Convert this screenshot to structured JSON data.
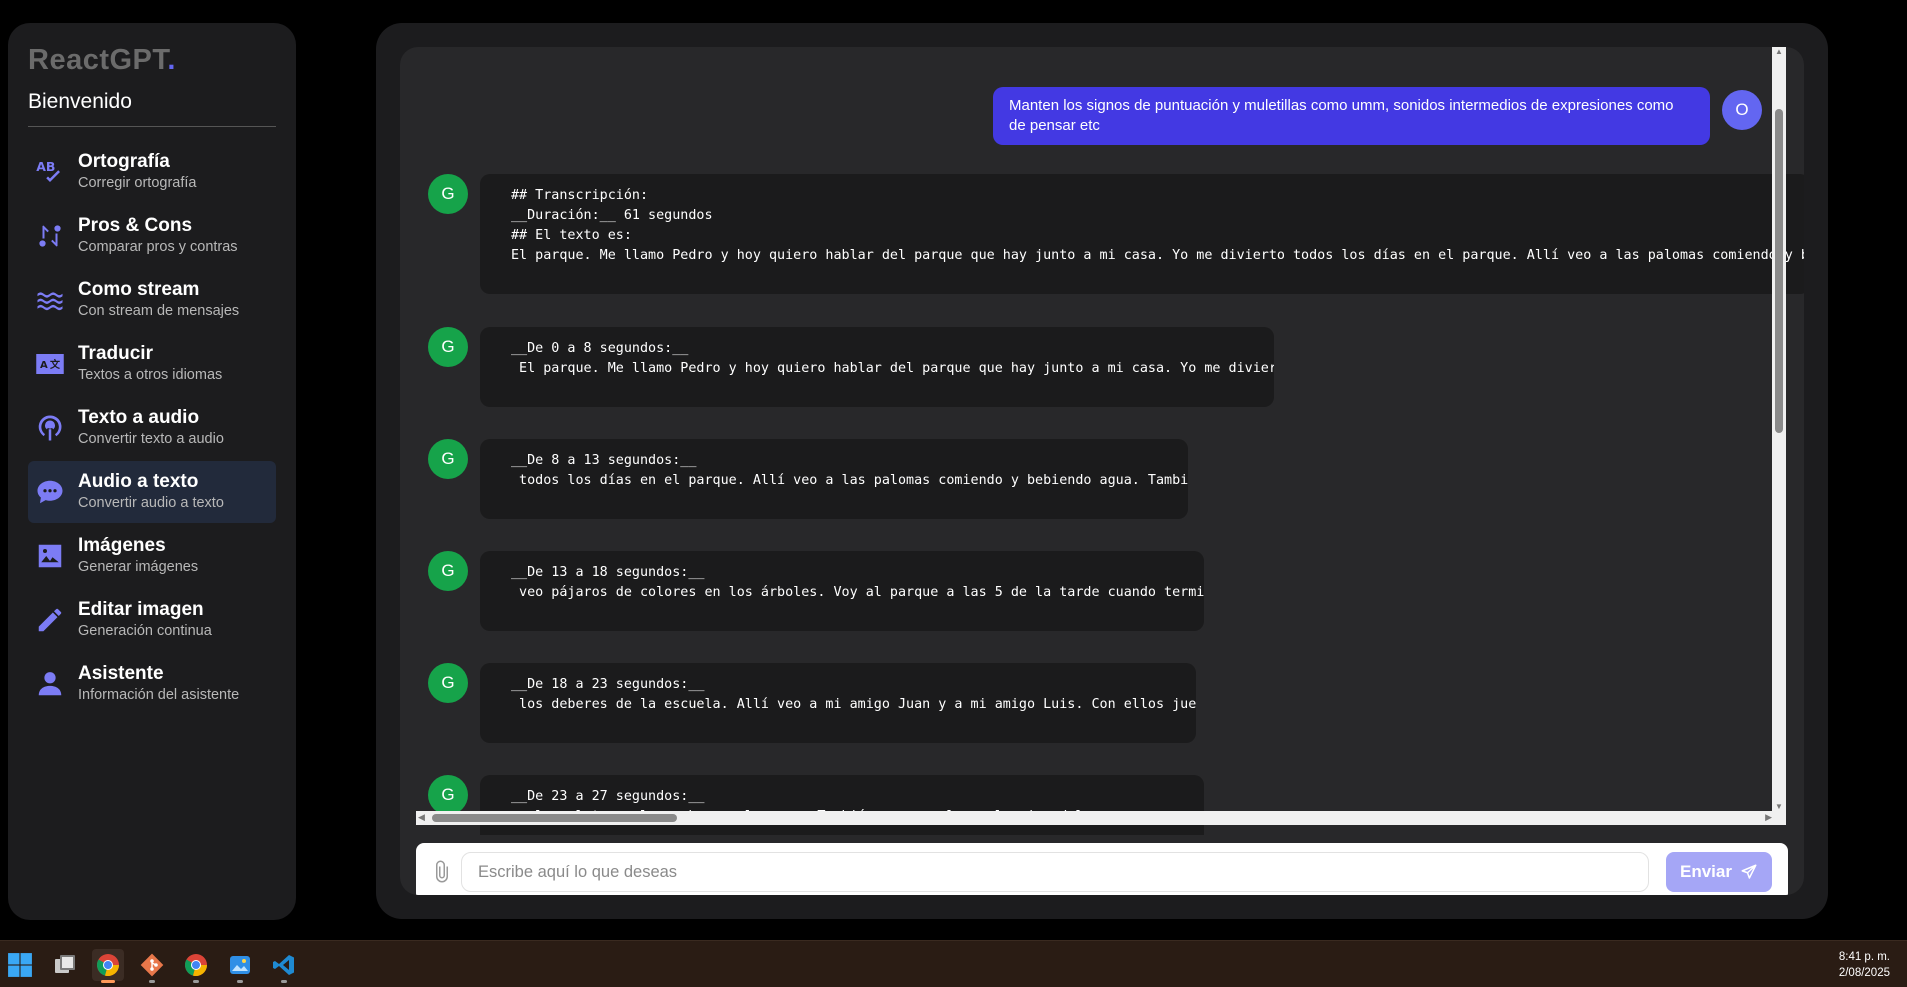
{
  "sidebar": {
    "brand": "ReactGPT",
    "brand_dot": ".",
    "welcome": "Bienvenido",
    "items": [
      {
        "title": "Ortografía",
        "subtitle": "Corregir ortografía",
        "icon": "spellcheck-icon"
      },
      {
        "title": "Pros & Cons",
        "subtitle": "Comparar pros y contras",
        "icon": "compare-icon"
      },
      {
        "title": "Como stream",
        "subtitle": "Con stream de mensajes",
        "icon": "waves-icon"
      },
      {
        "title": "Traducir",
        "subtitle": "Textos a otros idiomas",
        "icon": "translate-icon"
      },
      {
        "title": "Texto a audio",
        "subtitle": "Convertir texto a audio",
        "icon": "podcast-icon"
      },
      {
        "title": "Audio a texto",
        "subtitle": "Convertir audio a texto",
        "icon": "chat-bubble-icon",
        "active": true
      },
      {
        "title": "Imágenes",
        "subtitle": "Generar imágenes",
        "icon": "image-icon"
      },
      {
        "title": "Editar imagen",
        "subtitle": "Generación continua",
        "icon": "pencil-icon"
      },
      {
        "title": "Asistente",
        "subtitle": "Información del asistente",
        "icon": "person-icon"
      }
    ]
  },
  "chat": {
    "user_message": "Manten los signos de puntuación y muletillas como umm, sonidos intermedios de expresiones como de pensar etc",
    "user_avatar": "O",
    "bot_avatar": "G",
    "bot_messages": [
      "## Transcripción:\n__Duración:__ 61 segundos\n## El texto es:\nEl parque. Me llamo Pedro y hoy quiero hablar del parque que hay junto a mi casa. Yo me divierto todos los días en el parque. Allí veo a las palomas comiendo y bebiendo agua.",
      "__De 0 a 8 segundos:__\n El parque. Me llamo Pedro y hoy quiero hablar del parque que hay junto a mi casa. Yo me divierto",
      "__De 8 a 13 segundos:__\n todos los días en el parque. Allí veo a las palomas comiendo y bebiendo agua. También",
      "__De 13 a 18 segundos:__\n veo pájaros de colores en los árboles. Voy al parque a las 5 de la tarde cuando termino",
      "__De 18 a 23 segundos:__\n los deberes de la escuela. Allí veo a mi amigo Juan y a mi amigo Luis. Con ellos juego",
      "__De 23 a 27 segundos:__\n a la pelota, a la comba y a la goma. También vamos a los columpios del parque."
    ]
  },
  "input": {
    "placeholder": "Escribe aquí lo que deseas",
    "send_label": "Enviar"
  },
  "taskbar": {
    "time": "8:41 p. m.",
    "date": "2/08/2025",
    "apps": [
      "windows-start-icon",
      "task-view-icon",
      "chrome-icon",
      "git-icon",
      "chrome-icon",
      "photos-icon",
      "vscode-icon"
    ]
  },
  "colors": {
    "accent": "#6366f1",
    "user_bubble": "#4339e3",
    "bot_avatar": "#16a34a",
    "send_button": "#a5a6f6"
  }
}
